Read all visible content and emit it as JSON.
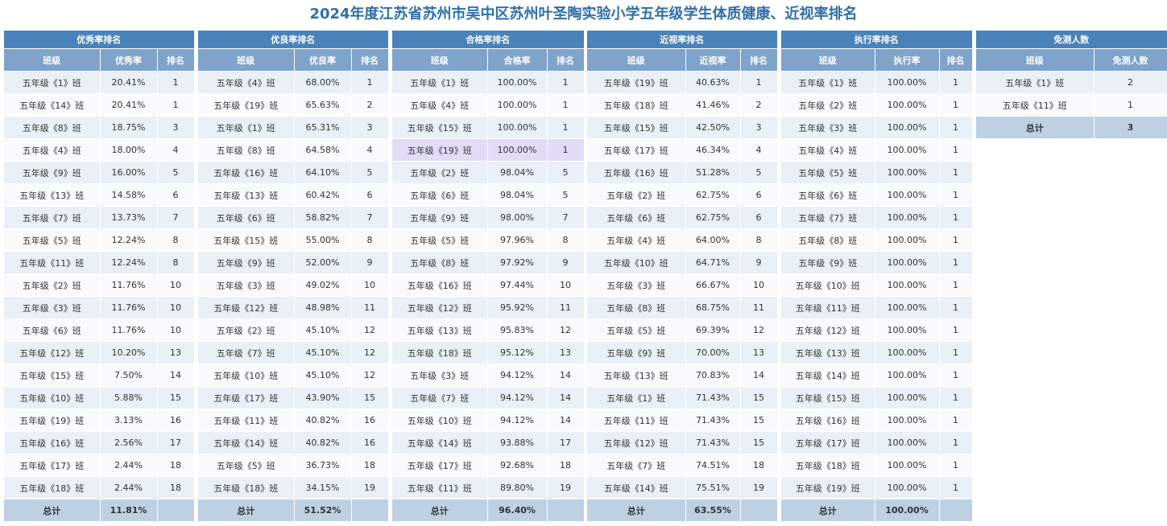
{
  "title": "2024年度江苏省苏州市吴中区苏州叶圣陶实验小学五年级学生体质健康、近视率排名",
  "tables": [
    {
      "caption": "优秀率排名",
      "columns": [
        "班级",
        "优秀率",
        "排名"
      ],
      "rows": [
        [
          "五年级《1》班",
          "20.41%",
          "1"
        ],
        [
          "五年级《14》班",
          "20.41%",
          "1"
        ],
        [
          "五年级《8》班",
          "18.75%",
          "3"
        ],
        [
          "五年级《4》班",
          "18.00%",
          "4"
        ],
        [
          "五年级《9》班",
          "16.00%",
          "5"
        ],
        [
          "五年级《13》班",
          "14.58%",
          "6"
        ],
        [
          "五年级《7》班",
          "13.73%",
          "7"
        ],
        [
          "五年级《5》班",
          "12.24%",
          "8"
        ],
        [
          "五年级《11》班",
          "12.24%",
          "8"
        ],
        [
          "五年级《2》班",
          "11.76%",
          "10"
        ],
        [
          "五年级《3》班",
          "11.76%",
          "10"
        ],
        [
          "五年级《6》班",
          "11.76%",
          "10"
        ],
        [
          "五年级《12》班",
          "10.20%",
          "13"
        ],
        [
          "五年级《15》班",
          "7.50%",
          "14"
        ],
        [
          "五年级《10》班",
          "5.88%",
          "15"
        ],
        [
          "五年级《19》班",
          "3.13%",
          "16"
        ],
        [
          "五年级《16》班",
          "2.56%",
          "17"
        ],
        [
          "五年级《17》班",
          "2.44%",
          "18"
        ],
        [
          "五年级《18》班",
          "2.44%",
          "18"
        ]
      ],
      "footer": [
        "总计",
        "11.81%",
        ""
      ]
    },
    {
      "caption": "优良率排名",
      "columns": [
        "班级",
        "优良率",
        "排名"
      ],
      "rows": [
        [
          "五年级《4》班",
          "68.00%",
          "1"
        ],
        [
          "五年级《19》班",
          "65.63%",
          "2"
        ],
        [
          "五年级《1》班",
          "65.31%",
          "3"
        ],
        [
          "五年级《8》班",
          "64.58%",
          "4"
        ],
        [
          "五年级《16》班",
          "64.10%",
          "5"
        ],
        [
          "五年级《13》班",
          "60.42%",
          "6"
        ],
        [
          "五年级《6》班",
          "58.82%",
          "7"
        ],
        [
          "五年级《15》班",
          "55.00%",
          "8"
        ],
        [
          "五年级《9》班",
          "52.00%",
          "9"
        ],
        [
          "五年级《3》班",
          "49.02%",
          "10"
        ],
        [
          "五年级《12》班",
          "48.98%",
          "11"
        ],
        [
          "五年级《2》班",
          "45.10%",
          "12"
        ],
        [
          "五年级《7》班",
          "45.10%",
          "12"
        ],
        [
          "五年级《10》班",
          "45.10%",
          "12"
        ],
        [
          "五年级《17》班",
          "43.90%",
          "15"
        ],
        [
          "五年级《11》班",
          "40.82%",
          "16"
        ],
        [
          "五年级《14》班",
          "40.82%",
          "16"
        ],
        [
          "五年级《5》班",
          "36.73%",
          "18"
        ],
        [
          "五年级《18》班",
          "34.15%",
          "19"
        ]
      ],
      "footer": [
        "总计",
        "51.52%",
        ""
      ]
    },
    {
      "caption": "合格率排名",
      "columns": [
        "班级",
        "合格率",
        "排名"
      ],
      "highlight_row": 3,
      "rows": [
        [
          "五年级《1》班",
          "100.00%",
          "1"
        ],
        [
          "五年级《4》班",
          "100.00%",
          "1"
        ],
        [
          "五年级《15》班",
          "100.00%",
          "1"
        ],
        [
          "五年级《19》班",
          "100.00%",
          "1"
        ],
        [
          "五年级《2》班",
          "98.04%",
          "5"
        ],
        [
          "五年级《6》班",
          "98.04%",
          "5"
        ],
        [
          "五年级《9》班",
          "98.00%",
          "7"
        ],
        [
          "五年级《5》班",
          "97.96%",
          "8"
        ],
        [
          "五年级《8》班",
          "97.92%",
          "9"
        ],
        [
          "五年级《16》班",
          "97.44%",
          "10"
        ],
        [
          "五年级《12》班",
          "95.92%",
          "11"
        ],
        [
          "五年级《13》班",
          "95.83%",
          "12"
        ],
        [
          "五年级《18》班",
          "95.12%",
          "13"
        ],
        [
          "五年级《3》班",
          "94.12%",
          "14"
        ],
        [
          "五年级《7》班",
          "94.12%",
          "14"
        ],
        [
          "五年级《10》班",
          "94.12%",
          "14"
        ],
        [
          "五年级《14》班",
          "93.88%",
          "17"
        ],
        [
          "五年级《17》班",
          "92.68%",
          "18"
        ],
        [
          "五年级《11》班",
          "89.80%",
          "19"
        ]
      ],
      "footer": [
        "总计",
        "96.40%",
        ""
      ]
    },
    {
      "caption": "近视率排名",
      "columns": [
        "班级",
        "近视率",
        "排名"
      ],
      "rows": [
        [
          "五年级《19》班",
          "40.63%",
          "1"
        ],
        [
          "五年级《18》班",
          "41.46%",
          "2"
        ],
        [
          "五年级《15》班",
          "42.50%",
          "3"
        ],
        [
          "五年级《17》班",
          "46.34%",
          "4"
        ],
        [
          "五年级《16》班",
          "51.28%",
          "5"
        ],
        [
          "五年级《2》班",
          "62.75%",
          "6"
        ],
        [
          "五年级《6》班",
          "62.75%",
          "6"
        ],
        [
          "五年级《4》班",
          "64.00%",
          "8"
        ],
        [
          "五年级《10》班",
          "64.71%",
          "9"
        ],
        [
          "五年级《3》班",
          "66.67%",
          "10"
        ],
        [
          "五年级《8》班",
          "68.75%",
          "11"
        ],
        [
          "五年级《5》班",
          "69.39%",
          "12"
        ],
        [
          "五年级《9》班",
          "70.00%",
          "13"
        ],
        [
          "五年级《13》班",
          "70.83%",
          "14"
        ],
        [
          "五年级《1》班",
          "71.43%",
          "15"
        ],
        [
          "五年级《11》班",
          "71.43%",
          "15"
        ],
        [
          "五年级《12》班",
          "71.43%",
          "15"
        ],
        [
          "五年级《7》班",
          "74.51%",
          "18"
        ],
        [
          "五年级《14》班",
          "75.51%",
          "19"
        ]
      ],
      "footer": [
        "总计",
        "63.55%",
        ""
      ]
    },
    {
      "caption": "执行率排名",
      "columns": [
        "班级",
        "执行率",
        "排名"
      ],
      "rows": [
        [
          "五年级《1》班",
          "100.00%",
          "1"
        ],
        [
          "五年级《2》班",
          "100.00%",
          "1"
        ],
        [
          "五年级《3》班",
          "100.00%",
          "1"
        ],
        [
          "五年级《4》班",
          "100.00%",
          "1"
        ],
        [
          "五年级《5》班",
          "100.00%",
          "1"
        ],
        [
          "五年级《6》班",
          "100.00%",
          "1"
        ],
        [
          "五年级《7》班",
          "100.00%",
          "1"
        ],
        [
          "五年级《8》班",
          "100.00%",
          "1"
        ],
        [
          "五年级《9》班",
          "100.00%",
          "1"
        ],
        [
          "五年级《10》班",
          "100.00%",
          "1"
        ],
        [
          "五年级《11》班",
          "100.00%",
          "1"
        ],
        [
          "五年级《12》班",
          "100.00%",
          "1"
        ],
        [
          "五年级《13》班",
          "100.00%",
          "1"
        ],
        [
          "五年级《14》班",
          "100.00%",
          "1"
        ],
        [
          "五年级《15》班",
          "100.00%",
          "1"
        ],
        [
          "五年级《16》班",
          "100.00%",
          "1"
        ],
        [
          "五年级《17》班",
          "100.00%",
          "1"
        ],
        [
          "五年级《18》班",
          "100.00%",
          "1"
        ],
        [
          "五年级《19》班",
          "100.00%",
          "1"
        ]
      ],
      "footer": [
        "总计",
        "100.00%",
        ""
      ]
    },
    {
      "caption": "免测人数",
      "columns": [
        "班级",
        "免测人数"
      ],
      "rows": [
        [
          "五年级《1》班",
          "2"
        ],
        [
          "五年级《11》班",
          "1"
        ]
      ],
      "footer": [
        "总计",
        "3"
      ]
    }
  ]
}
